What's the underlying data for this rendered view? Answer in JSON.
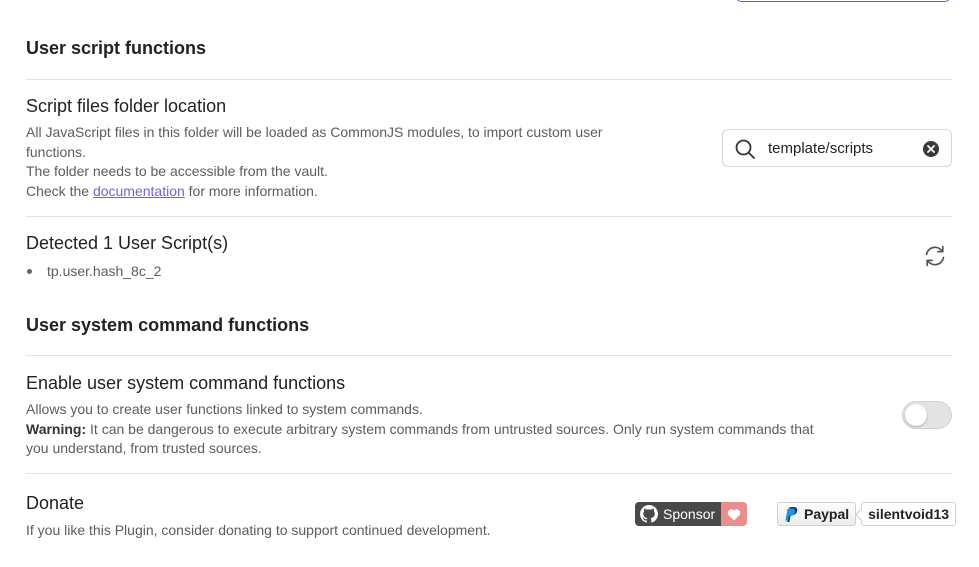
{
  "sections": {
    "user_script": {
      "heading": "User script functions"
    },
    "user_system": {
      "heading": "User system command functions"
    }
  },
  "script_folder": {
    "name": "Script files folder location",
    "desc_line1": "All JavaScript files in this folder will be loaded as CommonJS modules, to import custom user",
    "desc_line2": "functions.",
    "desc_line3": "The folder needs to be accessible from the vault.",
    "desc_prefix": "Check the ",
    "desc_link": "documentation",
    "desc_suffix": " for more information.",
    "input_value": "template/scripts",
    "search_icon": "search-icon",
    "clear_icon": "clear-icon"
  },
  "detected": {
    "name": "Detected 1 User Script(s)",
    "scripts": [
      "tp.user.hash_8c_2"
    ],
    "refresh_icon": "refresh-icon"
  },
  "enable_system": {
    "name": "Enable user system command functions",
    "desc_line1": "Allows you to create user functions linked to system commands.",
    "warning_label": "Warning:",
    "warning_text": " It can be dangerous to execute arbitrary system commands from untrusted sources. Only run system commands that",
    "desc_line3": "you understand, from trusted sources.",
    "toggle_on": false
  },
  "donate": {
    "name": "Donate",
    "desc": "If you like this Plugin, consider donating to support continued development.",
    "sponsor_label": "Sponsor",
    "paypal_label": "Paypal",
    "paypal_user": "silentvoid13"
  },
  "colors": {
    "accent": "#7b5cd6",
    "sponsor_dark": "#494949",
    "sponsor_heart_bg": "#ea8d8d",
    "divider": "#e3e3e3"
  }
}
